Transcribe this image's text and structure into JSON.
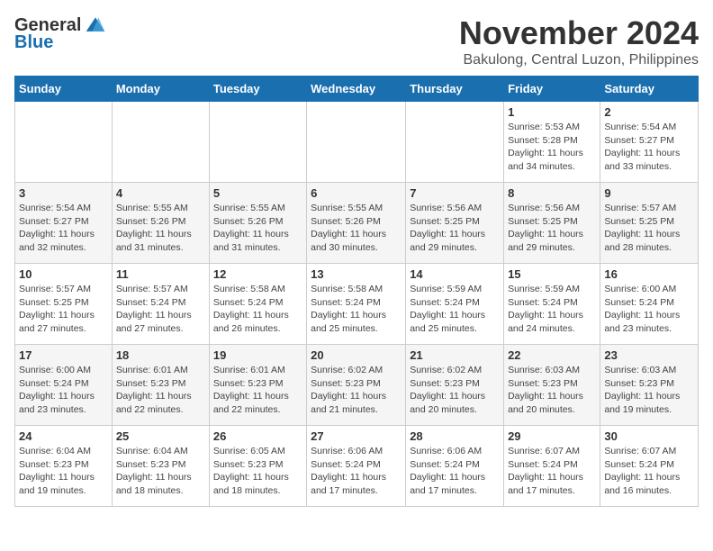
{
  "logo": {
    "general": "General",
    "blue": "Blue"
  },
  "title": "November 2024",
  "location": "Bakulong, Central Luzon, Philippines",
  "headers": [
    "Sunday",
    "Monday",
    "Tuesday",
    "Wednesday",
    "Thursday",
    "Friday",
    "Saturday"
  ],
  "weeks": [
    [
      {
        "day": "",
        "info": ""
      },
      {
        "day": "",
        "info": ""
      },
      {
        "day": "",
        "info": ""
      },
      {
        "day": "",
        "info": ""
      },
      {
        "day": "",
        "info": ""
      },
      {
        "day": "1",
        "info": "Sunrise: 5:53 AM\nSunset: 5:28 PM\nDaylight: 11 hours and 34 minutes."
      },
      {
        "day": "2",
        "info": "Sunrise: 5:54 AM\nSunset: 5:27 PM\nDaylight: 11 hours and 33 minutes."
      }
    ],
    [
      {
        "day": "3",
        "info": "Sunrise: 5:54 AM\nSunset: 5:27 PM\nDaylight: 11 hours and 32 minutes."
      },
      {
        "day": "4",
        "info": "Sunrise: 5:55 AM\nSunset: 5:26 PM\nDaylight: 11 hours and 31 minutes."
      },
      {
        "day": "5",
        "info": "Sunrise: 5:55 AM\nSunset: 5:26 PM\nDaylight: 11 hours and 31 minutes."
      },
      {
        "day": "6",
        "info": "Sunrise: 5:55 AM\nSunset: 5:26 PM\nDaylight: 11 hours and 30 minutes."
      },
      {
        "day": "7",
        "info": "Sunrise: 5:56 AM\nSunset: 5:25 PM\nDaylight: 11 hours and 29 minutes."
      },
      {
        "day": "8",
        "info": "Sunrise: 5:56 AM\nSunset: 5:25 PM\nDaylight: 11 hours and 29 minutes."
      },
      {
        "day": "9",
        "info": "Sunrise: 5:57 AM\nSunset: 5:25 PM\nDaylight: 11 hours and 28 minutes."
      }
    ],
    [
      {
        "day": "10",
        "info": "Sunrise: 5:57 AM\nSunset: 5:25 PM\nDaylight: 11 hours and 27 minutes."
      },
      {
        "day": "11",
        "info": "Sunrise: 5:57 AM\nSunset: 5:24 PM\nDaylight: 11 hours and 27 minutes."
      },
      {
        "day": "12",
        "info": "Sunrise: 5:58 AM\nSunset: 5:24 PM\nDaylight: 11 hours and 26 minutes."
      },
      {
        "day": "13",
        "info": "Sunrise: 5:58 AM\nSunset: 5:24 PM\nDaylight: 11 hours and 25 minutes."
      },
      {
        "day": "14",
        "info": "Sunrise: 5:59 AM\nSunset: 5:24 PM\nDaylight: 11 hours and 25 minutes."
      },
      {
        "day": "15",
        "info": "Sunrise: 5:59 AM\nSunset: 5:24 PM\nDaylight: 11 hours and 24 minutes."
      },
      {
        "day": "16",
        "info": "Sunrise: 6:00 AM\nSunset: 5:24 PM\nDaylight: 11 hours and 23 minutes."
      }
    ],
    [
      {
        "day": "17",
        "info": "Sunrise: 6:00 AM\nSunset: 5:24 PM\nDaylight: 11 hours and 23 minutes."
      },
      {
        "day": "18",
        "info": "Sunrise: 6:01 AM\nSunset: 5:23 PM\nDaylight: 11 hours and 22 minutes."
      },
      {
        "day": "19",
        "info": "Sunrise: 6:01 AM\nSunset: 5:23 PM\nDaylight: 11 hours and 22 minutes."
      },
      {
        "day": "20",
        "info": "Sunrise: 6:02 AM\nSunset: 5:23 PM\nDaylight: 11 hours and 21 minutes."
      },
      {
        "day": "21",
        "info": "Sunrise: 6:02 AM\nSunset: 5:23 PM\nDaylight: 11 hours and 20 minutes."
      },
      {
        "day": "22",
        "info": "Sunrise: 6:03 AM\nSunset: 5:23 PM\nDaylight: 11 hours and 20 minutes."
      },
      {
        "day": "23",
        "info": "Sunrise: 6:03 AM\nSunset: 5:23 PM\nDaylight: 11 hours and 19 minutes."
      }
    ],
    [
      {
        "day": "24",
        "info": "Sunrise: 6:04 AM\nSunset: 5:23 PM\nDaylight: 11 hours and 19 minutes."
      },
      {
        "day": "25",
        "info": "Sunrise: 6:04 AM\nSunset: 5:23 PM\nDaylight: 11 hours and 18 minutes."
      },
      {
        "day": "26",
        "info": "Sunrise: 6:05 AM\nSunset: 5:23 PM\nDaylight: 11 hours and 18 minutes."
      },
      {
        "day": "27",
        "info": "Sunrise: 6:06 AM\nSunset: 5:24 PM\nDaylight: 11 hours and 17 minutes."
      },
      {
        "day": "28",
        "info": "Sunrise: 6:06 AM\nSunset: 5:24 PM\nDaylight: 11 hours and 17 minutes."
      },
      {
        "day": "29",
        "info": "Sunrise: 6:07 AM\nSunset: 5:24 PM\nDaylight: 11 hours and 17 minutes."
      },
      {
        "day": "30",
        "info": "Sunrise: 6:07 AM\nSunset: 5:24 PM\nDaylight: 11 hours and 16 minutes."
      }
    ]
  ]
}
